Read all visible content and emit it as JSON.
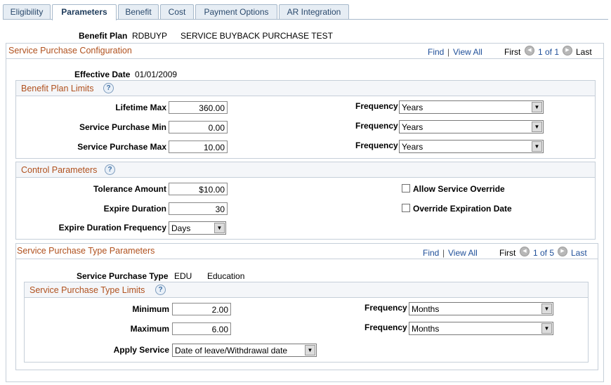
{
  "tabs": [
    "Eligibility",
    "Parameters",
    "Benefit",
    "Cost",
    "Payment Options",
    "AR Integration"
  ],
  "header": {
    "label": "Benefit Plan",
    "code": "RDBUYP",
    "description": "SERVICE BUYBACK PURCHASE TEST"
  },
  "config": {
    "title": "Service Purchase Configuration",
    "find": "Find",
    "separator": "|",
    "view_all": "View All",
    "first": "First",
    "count": "1 of 1",
    "last": "Last",
    "effective_date_label": "Effective Date",
    "effective_date": "01/01/2009"
  },
  "limits": {
    "title": "Benefit Plan Limits",
    "help": "?",
    "rows": [
      {
        "label": "Lifetime Max",
        "value": "360.00",
        "freq_label": "Frequency",
        "freq": "Years"
      },
      {
        "label": "Service Purchase Min",
        "value": "0.00",
        "freq_label": "Frequency",
        "freq": "Years"
      },
      {
        "label": "Service Purchase Max",
        "value": "10.00",
        "freq_label": "Frequency",
        "freq": "Years"
      }
    ]
  },
  "control": {
    "title": "Control Parameters",
    "help": "?",
    "tolerance_label": "Tolerance Amount",
    "tolerance": "$10.00",
    "expire_label": "Expire Duration",
    "expire": "30",
    "expire_freq_label": "Expire Duration Frequency",
    "expire_freq": "Days",
    "allow_override_label": "Allow Service Override",
    "allow_override_checked": false,
    "override_exp_label": "Override Expiration Date",
    "override_exp_checked": false
  },
  "type_params": {
    "title": "Service Purchase Type Parameters",
    "find": "Find",
    "separator": "|",
    "view_all": "View All",
    "first": "First",
    "count": "1 of 5",
    "last": "Last",
    "type_label": "Service Purchase Type",
    "type_code": "EDU",
    "type_desc": "Education",
    "limits_title": "Service Purchase Type Limits",
    "help": "?",
    "min_label": "Minimum",
    "min": "2.00",
    "min_freq_label": "Frequency",
    "min_freq": "Months",
    "max_label": "Maximum",
    "max": "6.00",
    "max_freq_label": "Frequency",
    "max_freq": "Months",
    "apply_label": "Apply Service",
    "apply": "Date of leave/Withdrawal date"
  },
  "colors": {
    "section_title": "#b0511e",
    "link": "#1f4f99",
    "border": "#c6cfd9"
  }
}
